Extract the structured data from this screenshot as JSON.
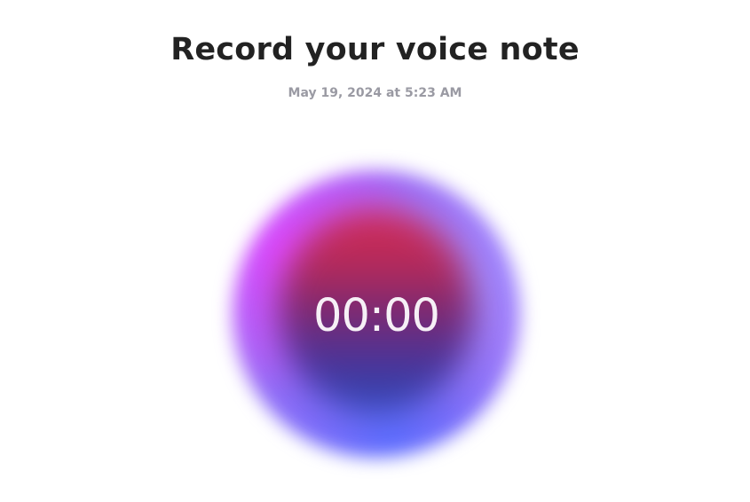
{
  "page": {
    "title": "Record your voice note",
    "timestamp": "May 19, 2024 at 5:23 AM"
  },
  "recorder": {
    "timer": "00:00",
    "colors": {
      "outer_magenta": "#e046ff",
      "outer_violet": "#a08cff",
      "outer_blue": "#5a6eff",
      "inner_top_red": "#d42c55",
      "inner_bottom_blue": "#2f4bb8",
      "timer_text": "#f6f0f6"
    }
  }
}
